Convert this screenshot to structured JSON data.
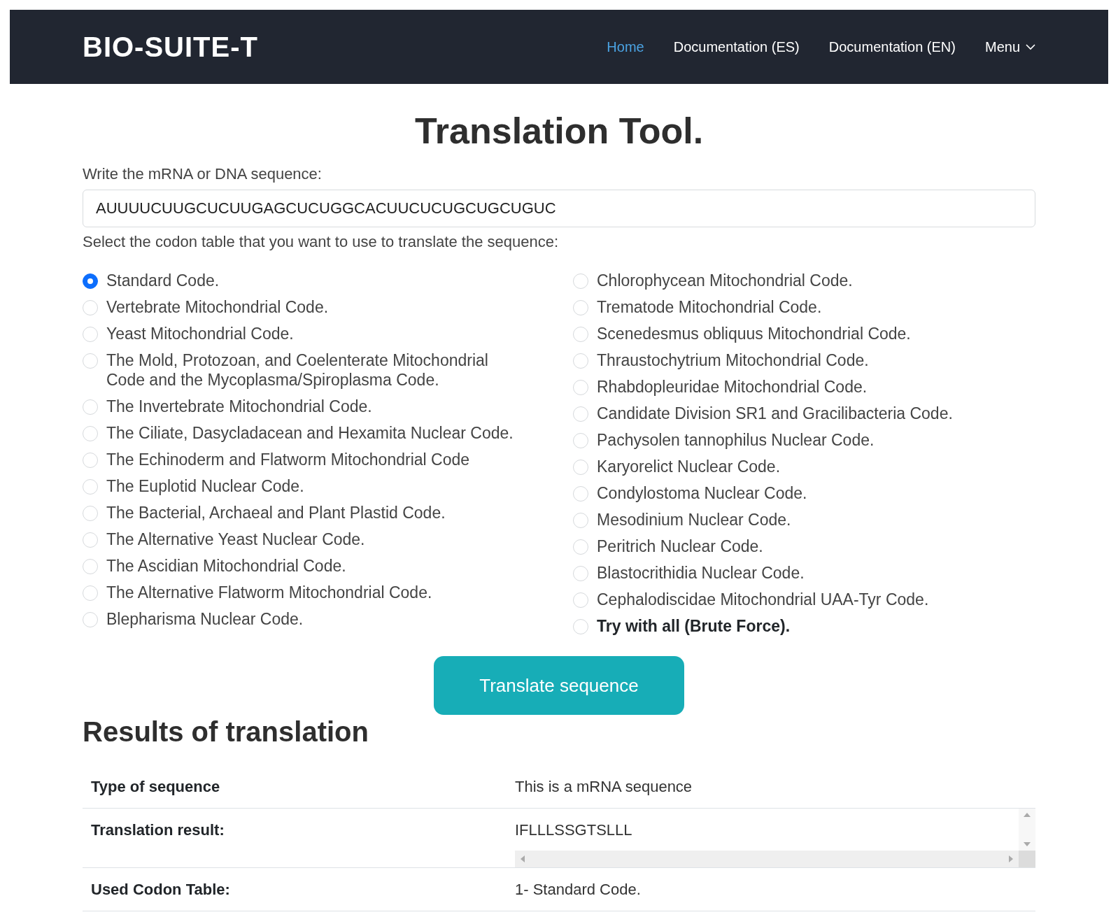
{
  "navbar": {
    "brand": "BIO-SUITE-T",
    "links": [
      {
        "label": "Home",
        "selected": true,
        "dropdown": false
      },
      {
        "label": "Documentation (ES)",
        "selected": false,
        "dropdown": false
      },
      {
        "label": "Documentation (EN)",
        "selected": false,
        "dropdown": false
      },
      {
        "label": "Menu",
        "selected": false,
        "dropdown": true
      }
    ]
  },
  "title": "Translation Tool.",
  "sequence_field": {
    "label": "Write the mRNA or DNA sequence:",
    "value": "AUUUUCUUGCUCUUGAGCUCUGGCACUUCUCUGCUGCUGUC"
  },
  "codon_table": {
    "label": "Select the codon table that you want to use to translate the sequence:",
    "columns": [
      [
        {
          "label": "Standard Code.",
          "selected": true,
          "bold": false
        },
        {
          "label": "Vertebrate Mitochondrial Code.",
          "selected": false,
          "bold": false
        },
        {
          "label": "Yeast Mitochondrial Code.",
          "selected": false,
          "bold": false
        },
        {
          "label": "The Mold, Protozoan, and Coelenterate Mitochondrial Code and the Mycoplasma/Spiroplasma Code.",
          "selected": false,
          "bold": false
        },
        {
          "label": "The Invertebrate Mitochondrial Code.",
          "selected": false,
          "bold": false
        },
        {
          "label": "The Ciliate, Dasycladacean and Hexamita Nuclear Code.",
          "selected": false,
          "bold": false
        },
        {
          "label": "The Echinoderm and Flatworm Mitochondrial Code",
          "selected": false,
          "bold": false
        },
        {
          "label": "The Euplotid Nuclear Code.",
          "selected": false,
          "bold": false
        },
        {
          "label": "The Bacterial, Archaeal and Plant Plastid Code.",
          "selected": false,
          "bold": false
        },
        {
          "label": "The Alternative Yeast Nuclear Code.",
          "selected": false,
          "bold": false
        },
        {
          "label": "The Ascidian Mitochondrial Code.",
          "selected": false,
          "bold": false
        },
        {
          "label": "The Alternative Flatworm Mitochondrial Code.",
          "selected": false,
          "bold": false
        },
        {
          "label": "Blepharisma Nuclear Code.",
          "selected": false,
          "bold": false
        }
      ],
      [
        {
          "label": "Chlorophycean Mitochondrial Code.",
          "selected": false,
          "bold": false
        },
        {
          "label": "Trematode Mitochondrial Code.",
          "selected": false,
          "bold": false
        },
        {
          "label": "Scenedesmus obliquus Mitochondrial Code.",
          "selected": false,
          "bold": false
        },
        {
          "label": "Thraustochytrium Mitochondrial Code.",
          "selected": false,
          "bold": false
        },
        {
          "label": "Rhabdopleuridae Mitochondrial Code.",
          "selected": false,
          "bold": false
        },
        {
          "label": "Candidate Division SR1 and Gracilibacteria Code.",
          "selected": false,
          "bold": false
        },
        {
          "label": "Pachysolen tannophilus Nuclear Code.",
          "selected": false,
          "bold": false
        },
        {
          "label": "Karyorelict Nuclear Code.",
          "selected": false,
          "bold": false
        },
        {
          "label": "Condylostoma Nuclear Code.",
          "selected": false,
          "bold": false
        },
        {
          "label": "Mesodinium Nuclear Code.",
          "selected": false,
          "bold": false
        },
        {
          "label": "Peritrich Nuclear Code.",
          "selected": false,
          "bold": false
        },
        {
          "label": "Blastocrithidia Nuclear Code.",
          "selected": false,
          "bold": false
        },
        {
          "label": "Cephalodiscidae Mitochondrial UAA-Tyr Code.",
          "selected": false,
          "bold": false
        },
        {
          "label": "Try with all (Brute Force).",
          "selected": false,
          "bold": true
        }
      ]
    ]
  },
  "translate_button": "Translate sequence",
  "results": {
    "title": "Results of translation",
    "rows": [
      {
        "label": "Type of sequence",
        "value": "This is a mRNA sequence",
        "kind": "text"
      },
      {
        "label": "Translation result:",
        "value": "IFLLLSSGTSLLL",
        "kind": "scroll"
      },
      {
        "label": "Used Codon Table:",
        "value": "1- Standard Code.",
        "kind": "text"
      }
    ]
  }
}
